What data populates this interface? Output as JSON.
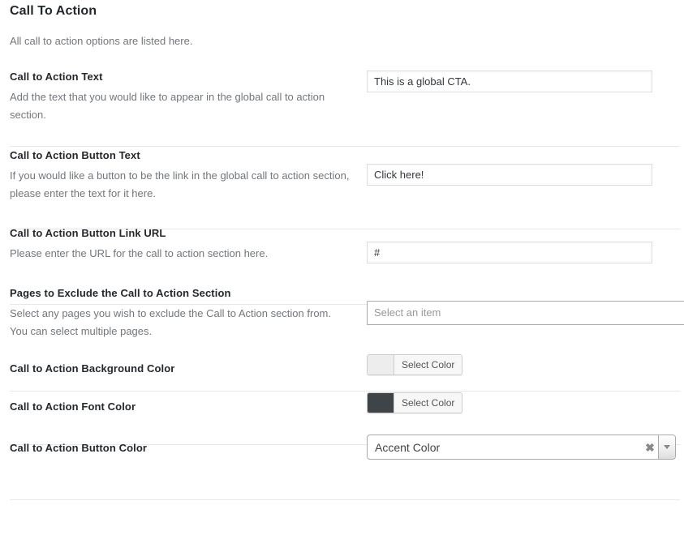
{
  "section": {
    "title": "Call To Action",
    "description": "All call to action options are listed here."
  },
  "fields": [
    {
      "title": "Call to Action Text",
      "description": "Add the text that you would like to appear in the global call to action section.",
      "value": "This is a global CTA.",
      "placeholder": ""
    },
    {
      "title": "Call to Action Button Text",
      "description": "If you would like a button to be the link in the global call to action section, please enter the text for it here.",
      "value": "Click here!",
      "placeholder": ""
    },
    {
      "title": "Call to Action Button Link URL",
      "description": "Please enter the URL for the call to action section here.",
      "value": "#",
      "placeholder": ""
    },
    {
      "title": "Pages to Exclude the Call to Action Section",
      "description": "Select any pages you wish to exclude the Call to Action section from. You can select multiple pages.",
      "placeholder": "Select an item"
    },
    {
      "title": "Call to Action Background Color",
      "button_label": "Select Color",
      "swatch_color": "#ededed"
    },
    {
      "title": "Call to Action Font Color",
      "button_label": "Select Color",
      "swatch_color": "#3f4448"
    },
    {
      "title": "Call to Action Button Color",
      "selected_option": "Accent Color",
      "clear_glyph": "✖"
    }
  ]
}
